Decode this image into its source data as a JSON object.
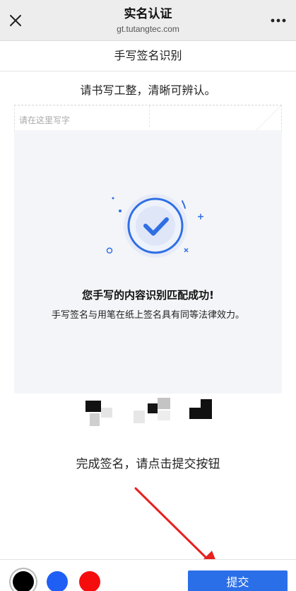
{
  "header": {
    "title": "实名认证",
    "url": "gt.tutangtec.com",
    "close_icon": "close-icon",
    "more_icon": "more-options-icon"
  },
  "section": {
    "title": "手写签名识别"
  },
  "instruction": "请书写工整，清晰可辨认。",
  "writing_area": {
    "placeholder": "请在这里写字"
  },
  "success_modal": {
    "icon": "check-circle-icon",
    "title": "您手写的内容识别匹配成功!",
    "description": "手写签名与用笔在纸上签名具有同等法律效力。",
    "accent_color": "#2f6fe4"
  },
  "hint": "完成签名，请点击提交按钮",
  "toolbar": {
    "colors": [
      {
        "name": "black",
        "hex": "#000000",
        "selected": true
      },
      {
        "name": "blue",
        "hex": "#1f5ff5",
        "selected": false
      },
      {
        "name": "red",
        "hex": "#f50d0d",
        "selected": false
      }
    ],
    "submit_label": "提交",
    "submit_color": "#2b6fe8"
  },
  "annotation": {
    "arrow_color": "#e82020"
  }
}
